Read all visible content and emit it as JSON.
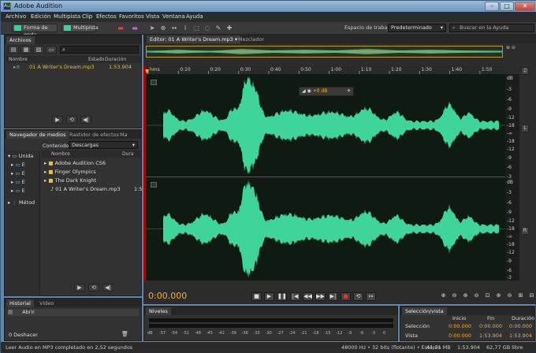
{
  "window": {
    "title": "Adobe Audition",
    "app_icon": "Au"
  },
  "menu": [
    "Archivo",
    "Edición",
    "Multipista",
    "Clip",
    "Efectos",
    "Favoritos",
    "Vista",
    "Ventana",
    "Ayuda"
  ],
  "toolbar": {
    "waveform_label": "Forma de onda",
    "multitrack_label": "Multipista",
    "workspace_label": "Espacio de trabajo:",
    "workspace_value": "Predeterminado",
    "search_placeholder": "Buscar en la Ayuda"
  },
  "files_panel": {
    "tab": "Archivos",
    "col_name": "Nombre",
    "col_status": "Estado",
    "col_duration": "Duración",
    "file_name": "01 A Writer's Dream.mp3",
    "file_duration": "1:53.904"
  },
  "media_panel": {
    "tabs": [
      "Navegador de medios",
      "Rastidor de efectos",
      "Ma"
    ],
    "contents_label": "Contenido:",
    "contents_value": "Descargas",
    "tree": [
      "Unida",
      "E",
      "E",
      "E",
      "E",
      "Métod"
    ],
    "col_name": "Nombre",
    "col_duration": "Dura",
    "items": [
      "Adobe Audition CS6",
      "Finger Olympics",
      "The Dark Knight",
      "01 A Writer's Dream.mp3"
    ],
    "item_duration": "1:5"
  },
  "history_panel": {
    "tabs": [
      "Historial",
      "Vídeo"
    ],
    "item": "Abrir",
    "undo_label": "0 Deshacer"
  },
  "editor": {
    "tab": "Editor: 01 A Writer's Dream.mp3",
    "mixer_tab": "Mezclador",
    "hud_value": "+0 dB",
    "time_labels": [
      "hms",
      "0:10",
      "0:20",
      "0:30",
      "0:40",
      "0:50",
      "1:00",
      "1:10",
      "1:20",
      "1:30",
      "1:40",
      "1:50"
    ],
    "db_labels_top": [
      "dB",
      "-3",
      "-6",
      "-9",
      "-12",
      "-18",
      "-∞",
      "-18",
      "-12",
      "-9",
      "-6",
      "-3"
    ],
    "db_labels_bottom": [
      "dB",
      "-3",
      "-6",
      "-9",
      "-12",
      "-18",
      "-∞",
      "-18",
      "-12",
      "-9",
      "-6",
      "-3"
    ],
    "channel_left": "L",
    "channel_right": "R",
    "current_time": "0:00.000"
  },
  "levels_panel": {
    "tab": "Niveles",
    "scale": [
      "dB",
      "-57",
      "-54",
      "-51",
      "-48",
      "-45",
      "-42",
      "-39",
      "-36",
      "-33",
      "-30",
      "-27",
      "-24",
      "-21",
      "-18",
      "-15",
      "-12",
      "-9",
      "-6",
      "-3",
      "0"
    ]
  },
  "selection_panel": {
    "tab": "Selección/vista",
    "col_start": "Inicio",
    "col_end": "Fin",
    "col_duration": "Duración",
    "row_selection": "Selección",
    "row_view": "Vista",
    "sel_start": "0:00.000",
    "sel_end": "0:00.000",
    "sel_duration": "0:00.000",
    "view_start": "0:00.000",
    "view_end": "1:53.904",
    "view_duration": "1:53.904"
  },
  "status": {
    "message": "Leer Audio en MP3 completado en 2,52 segundos",
    "format": "48000 Hz • 32 bits (flotante) • Estéreo",
    "size": "41,71 MB",
    "duration": "1:53.904",
    "free": "62,77 GB libre"
  },
  "colors": {
    "waveform": "#3fd49a",
    "time": "#f0b030",
    "panel": "#323232"
  }
}
